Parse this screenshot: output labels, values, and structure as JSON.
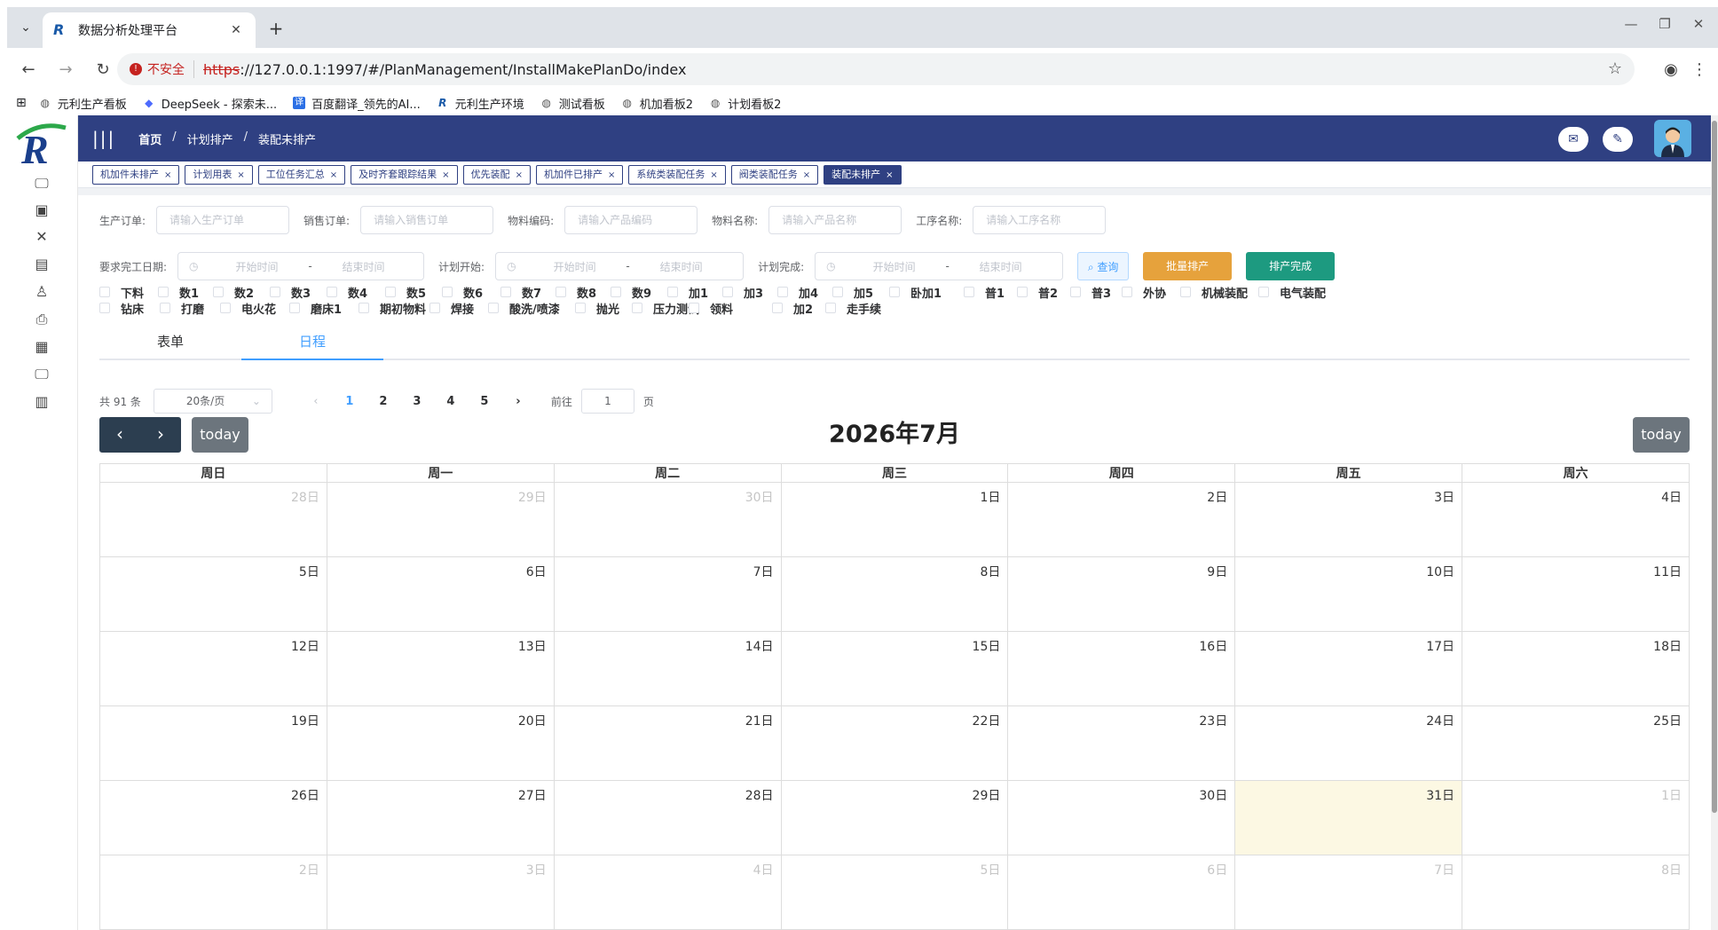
{
  "browser": {
    "tab_title": "数据分析处理平台",
    "new_tab": "+",
    "url_warning": "不安全",
    "url_scheme": "https",
    "url_rest": "://127.0.0.1:1997/#/PlanManagement/InstallMakePlanDo/index",
    "bookmarks": [
      "元利生产看板",
      "DeepSeek - 探索未...",
      "百度翻译_领先的AI...",
      "元利生产环境",
      "测试看板",
      "机加看板2",
      "计划看板2"
    ]
  },
  "header": {
    "breadcrumb": [
      "首页",
      "计划排产",
      "装配未排产"
    ]
  },
  "tags": [
    "机加件未排产",
    "计划用表",
    "工位任务汇总",
    "及时齐套跟踪结果",
    "优先装配",
    "机加件已排产",
    "系统类装配任务",
    "阀类装配任务",
    "装配未排产"
  ],
  "filters": {
    "row1": [
      {
        "label": "生产订单:",
        "placeholder": "请输入生产订单"
      },
      {
        "label": "销售订单:",
        "placeholder": "请输入销售订单"
      },
      {
        "label": "物料编码:",
        "placeholder": "请输入产品编码"
      },
      {
        "label": "物料名称:",
        "placeholder": "请输入产品名称"
      },
      {
        "label": "工序名称:",
        "placeholder": "请输入工序名称"
      }
    ],
    "row2": [
      {
        "label": "要求完工日期:",
        "start": "开始时间",
        "end": "结束时间"
      },
      {
        "label": "计划开始:",
        "start": "开始时间",
        "end": "结束时间"
      },
      {
        "label": "计划完成:",
        "start": "开始时间",
        "end": "结束时间"
      }
    ],
    "query": "查询",
    "batch": "批量排产",
    "done": "排产完成"
  },
  "checkboxes": {
    "row1": [
      "下料",
      "数1",
      "数2",
      "数3",
      "数4",
      "数5",
      "数6",
      "数7",
      "数8",
      "数9",
      "加1",
      "加3",
      "加4",
      "加5",
      "卧加1",
      "普1",
      "普2",
      "普3",
      "外协",
      "机械装配",
      "电气装配"
    ],
    "row2": [
      "钻床",
      "打磨",
      "电火花",
      "磨床1",
      "期初物料",
      "焊接",
      "酸洗/喷漆",
      "抛光",
      "压力测试",
      "领料",
      "加2",
      "走手续"
    ]
  },
  "view_tabs": [
    "表单",
    "日程"
  ],
  "pager": {
    "total": "共 91 条",
    "size": "20条/页",
    "pages": [
      "1",
      "2",
      "3",
      "4",
      "5"
    ],
    "goto": "前往",
    "goto_value": "1",
    "page_unit": "页"
  },
  "calendar": {
    "title": "2026年7月",
    "today": "today",
    "weekdays": [
      "周日",
      "周一",
      "周二",
      "周三",
      "周四",
      "周五",
      "周六"
    ],
    "weeks": [
      [
        "28日",
        "29日",
        "30日",
        "1日",
        "2日",
        "3日",
        "4日"
      ],
      [
        "5日",
        "6日",
        "7日",
        "8日",
        "9日",
        "10日",
        "11日"
      ],
      [
        "12日",
        "13日",
        "14日",
        "15日",
        "16日",
        "17日",
        "18日"
      ],
      [
        "19日",
        "20日",
        "21日",
        "22日",
        "23日",
        "24日",
        "25日"
      ],
      [
        "26日",
        "27日",
        "28日",
        "29日",
        "30日",
        "31日",
        "1日"
      ],
      [
        "2日",
        "3日",
        "4日",
        "5日",
        "6日",
        "7日",
        "8日"
      ]
    ],
    "highlight_color": "#fcf8e3"
  },
  "colors": {
    "topbar": "#2f4082",
    "accent": "#409eff"
  }
}
